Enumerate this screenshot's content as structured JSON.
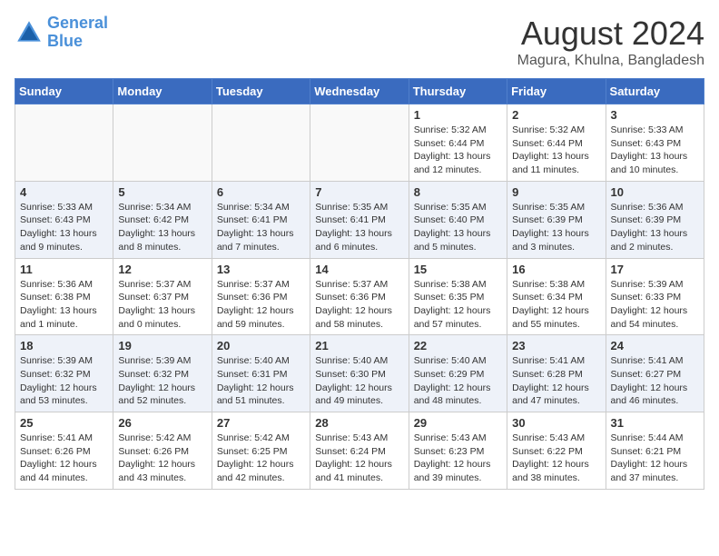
{
  "header": {
    "logo_line1": "General",
    "logo_line2": "Blue",
    "title": "August 2024",
    "subtitle": "Magura, Khulna, Bangladesh"
  },
  "weekdays": [
    "Sunday",
    "Monday",
    "Tuesday",
    "Wednesday",
    "Thursday",
    "Friday",
    "Saturday"
  ],
  "weeks": [
    [
      {
        "day": "",
        "info": ""
      },
      {
        "day": "",
        "info": ""
      },
      {
        "day": "",
        "info": ""
      },
      {
        "day": "",
        "info": ""
      },
      {
        "day": "1",
        "info": "Sunrise: 5:32 AM\nSunset: 6:44 PM\nDaylight: 13 hours\nand 12 minutes."
      },
      {
        "day": "2",
        "info": "Sunrise: 5:32 AM\nSunset: 6:44 PM\nDaylight: 13 hours\nand 11 minutes."
      },
      {
        "day": "3",
        "info": "Sunrise: 5:33 AM\nSunset: 6:43 PM\nDaylight: 13 hours\nand 10 minutes."
      }
    ],
    [
      {
        "day": "4",
        "info": "Sunrise: 5:33 AM\nSunset: 6:43 PM\nDaylight: 13 hours\nand 9 minutes."
      },
      {
        "day": "5",
        "info": "Sunrise: 5:34 AM\nSunset: 6:42 PM\nDaylight: 13 hours\nand 8 minutes."
      },
      {
        "day": "6",
        "info": "Sunrise: 5:34 AM\nSunset: 6:41 PM\nDaylight: 13 hours\nand 7 minutes."
      },
      {
        "day": "7",
        "info": "Sunrise: 5:35 AM\nSunset: 6:41 PM\nDaylight: 13 hours\nand 6 minutes."
      },
      {
        "day": "8",
        "info": "Sunrise: 5:35 AM\nSunset: 6:40 PM\nDaylight: 13 hours\nand 5 minutes."
      },
      {
        "day": "9",
        "info": "Sunrise: 5:35 AM\nSunset: 6:39 PM\nDaylight: 13 hours\nand 3 minutes."
      },
      {
        "day": "10",
        "info": "Sunrise: 5:36 AM\nSunset: 6:39 PM\nDaylight: 13 hours\nand 2 minutes."
      }
    ],
    [
      {
        "day": "11",
        "info": "Sunrise: 5:36 AM\nSunset: 6:38 PM\nDaylight: 13 hours\nand 1 minute."
      },
      {
        "day": "12",
        "info": "Sunrise: 5:37 AM\nSunset: 6:37 PM\nDaylight: 13 hours\nand 0 minutes."
      },
      {
        "day": "13",
        "info": "Sunrise: 5:37 AM\nSunset: 6:36 PM\nDaylight: 12 hours\nand 59 minutes."
      },
      {
        "day": "14",
        "info": "Sunrise: 5:37 AM\nSunset: 6:36 PM\nDaylight: 12 hours\nand 58 minutes."
      },
      {
        "day": "15",
        "info": "Sunrise: 5:38 AM\nSunset: 6:35 PM\nDaylight: 12 hours\nand 57 minutes."
      },
      {
        "day": "16",
        "info": "Sunrise: 5:38 AM\nSunset: 6:34 PM\nDaylight: 12 hours\nand 55 minutes."
      },
      {
        "day": "17",
        "info": "Sunrise: 5:39 AM\nSunset: 6:33 PM\nDaylight: 12 hours\nand 54 minutes."
      }
    ],
    [
      {
        "day": "18",
        "info": "Sunrise: 5:39 AM\nSunset: 6:32 PM\nDaylight: 12 hours\nand 53 minutes."
      },
      {
        "day": "19",
        "info": "Sunrise: 5:39 AM\nSunset: 6:32 PM\nDaylight: 12 hours\nand 52 minutes."
      },
      {
        "day": "20",
        "info": "Sunrise: 5:40 AM\nSunset: 6:31 PM\nDaylight: 12 hours\nand 51 minutes."
      },
      {
        "day": "21",
        "info": "Sunrise: 5:40 AM\nSunset: 6:30 PM\nDaylight: 12 hours\nand 49 minutes."
      },
      {
        "day": "22",
        "info": "Sunrise: 5:40 AM\nSunset: 6:29 PM\nDaylight: 12 hours\nand 48 minutes."
      },
      {
        "day": "23",
        "info": "Sunrise: 5:41 AM\nSunset: 6:28 PM\nDaylight: 12 hours\nand 47 minutes."
      },
      {
        "day": "24",
        "info": "Sunrise: 5:41 AM\nSunset: 6:27 PM\nDaylight: 12 hours\nand 46 minutes."
      }
    ],
    [
      {
        "day": "25",
        "info": "Sunrise: 5:41 AM\nSunset: 6:26 PM\nDaylight: 12 hours\nand 44 minutes."
      },
      {
        "day": "26",
        "info": "Sunrise: 5:42 AM\nSunset: 6:26 PM\nDaylight: 12 hours\nand 43 minutes."
      },
      {
        "day": "27",
        "info": "Sunrise: 5:42 AM\nSunset: 6:25 PM\nDaylight: 12 hours\nand 42 minutes."
      },
      {
        "day": "28",
        "info": "Sunrise: 5:43 AM\nSunset: 6:24 PM\nDaylight: 12 hours\nand 41 minutes."
      },
      {
        "day": "29",
        "info": "Sunrise: 5:43 AM\nSunset: 6:23 PM\nDaylight: 12 hours\nand 39 minutes."
      },
      {
        "day": "30",
        "info": "Sunrise: 5:43 AM\nSunset: 6:22 PM\nDaylight: 12 hours\nand 38 minutes."
      },
      {
        "day": "31",
        "info": "Sunrise: 5:44 AM\nSunset: 6:21 PM\nDaylight: 12 hours\nand 37 minutes."
      }
    ]
  ]
}
